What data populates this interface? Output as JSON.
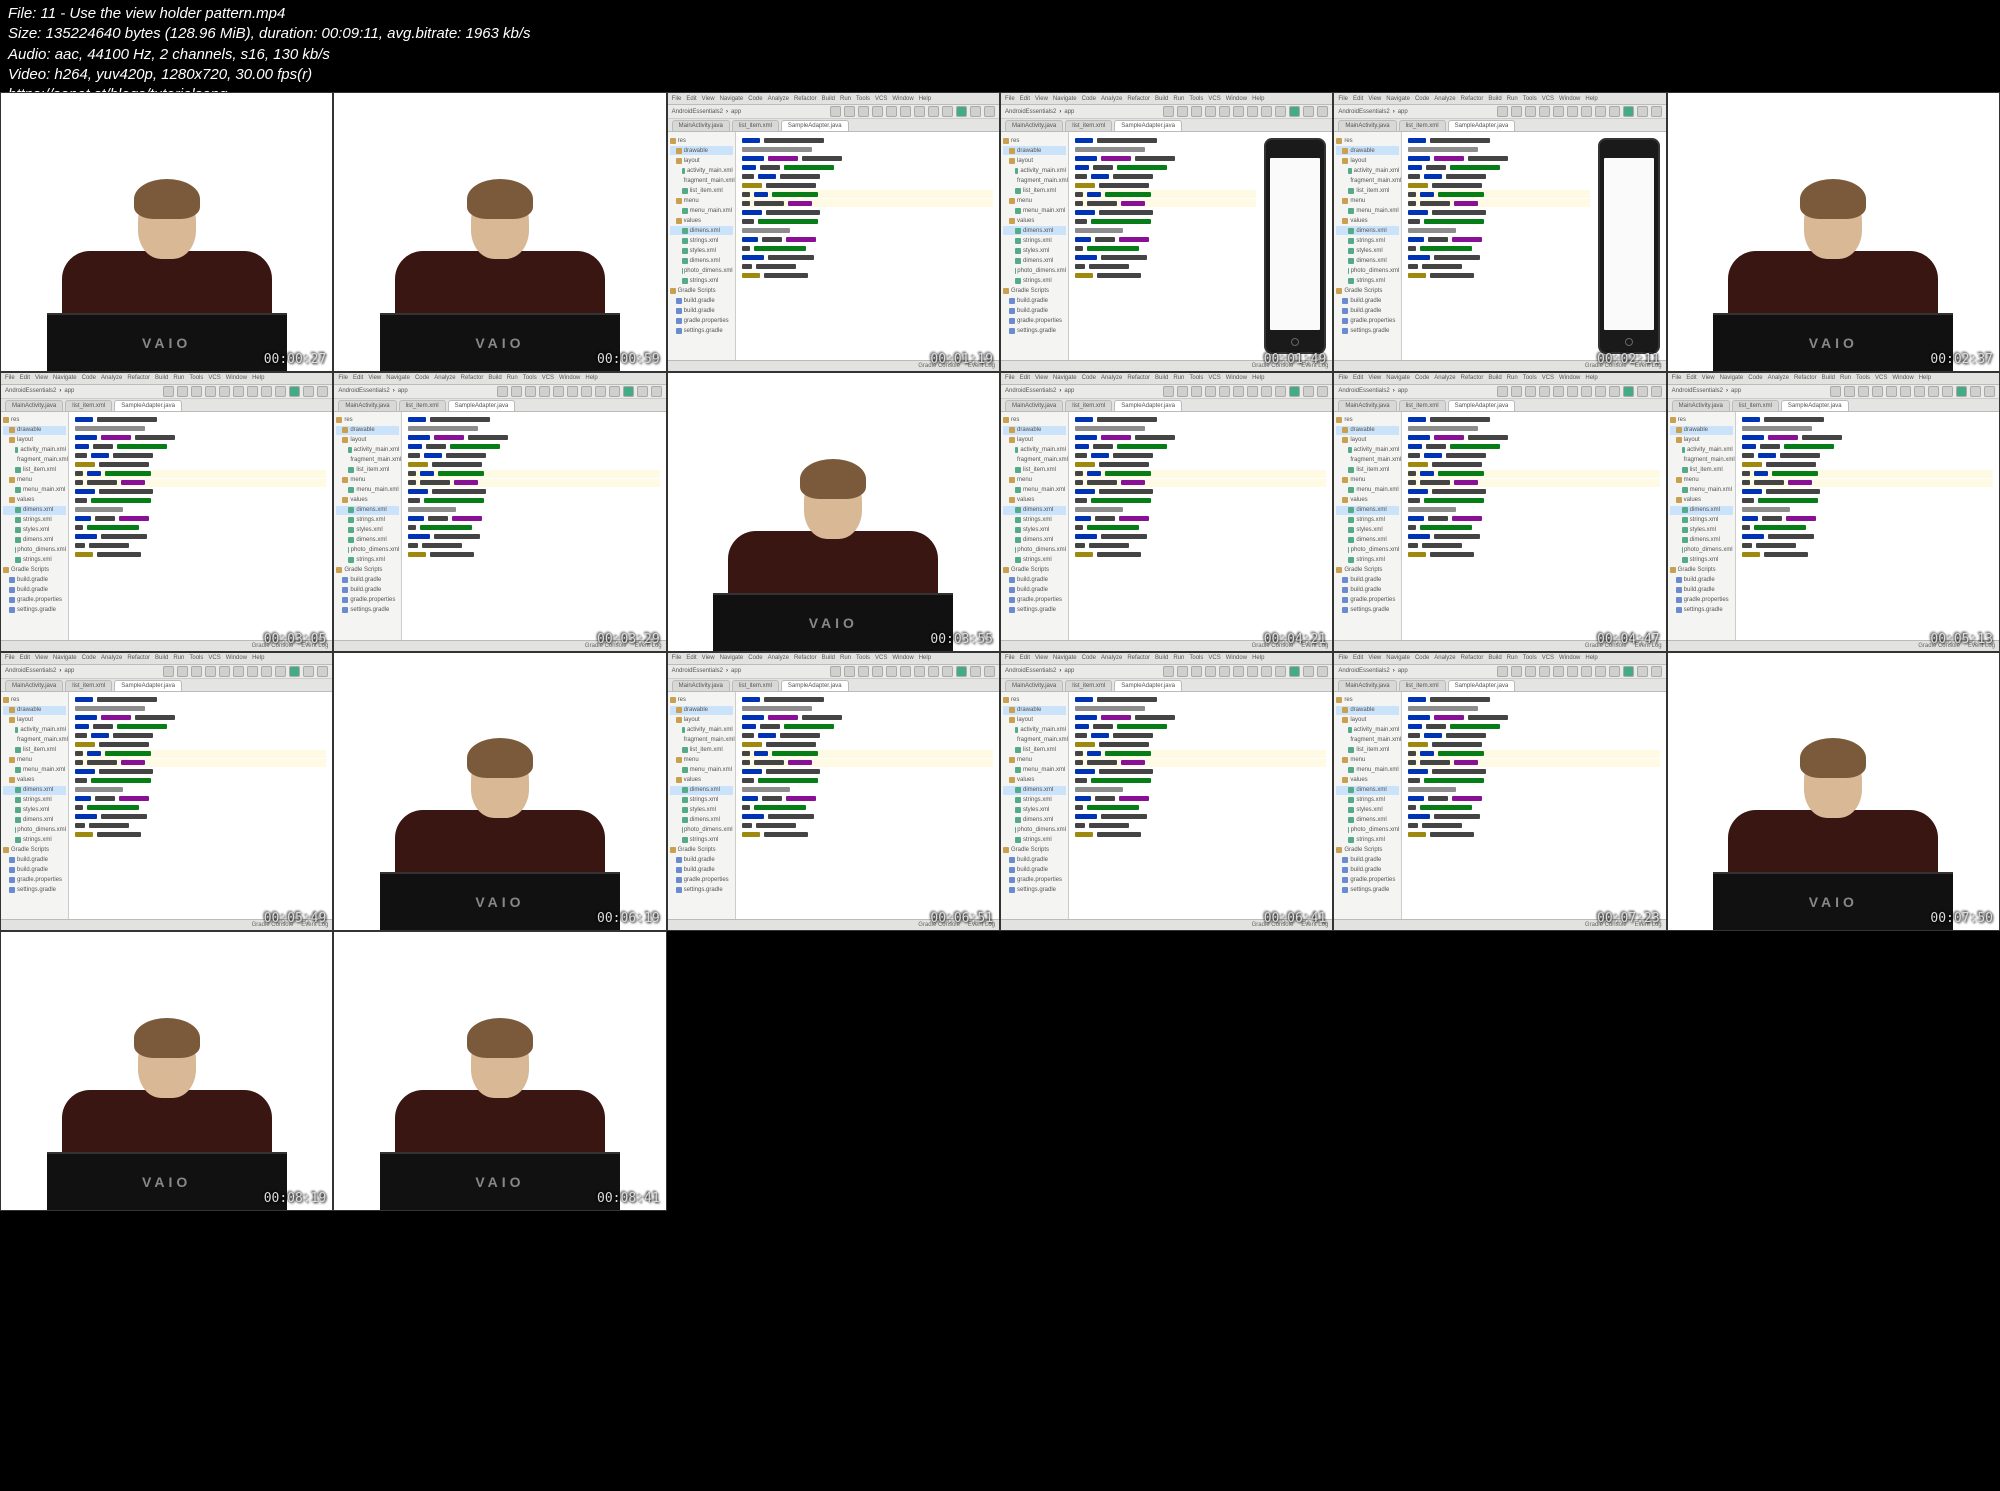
{
  "header": {
    "file": "File: 11 - Use the view holder pattern.mp4",
    "size": "Size: 135224640 bytes (128.96 MiB), duration: 00:09:11, avg.bitrate: 1963 kb/s",
    "audio": "Audio: aac, 44100 Hz, 2 channels, s16, 130 kb/s",
    "video": "Video: h264, yuv420p, 1280x720, 30.00 fps(r)",
    "url": "https://sanet.st/blogs/tutorialseng"
  },
  "ide": {
    "menu": [
      "File",
      "Edit",
      "View",
      "Navigate",
      "Code",
      "Analyze",
      "Refactor",
      "Build",
      "Run",
      "Tools",
      "VCS",
      "Window",
      "Help"
    ],
    "project_label": "AndroidEssentials2",
    "module_label": "app",
    "tabs": [
      "MainActivity.java",
      "list_item.xml",
      "SampleAdapter.java"
    ],
    "tree": [
      {
        "label": "res",
        "icon": "folder",
        "ind": 0
      },
      {
        "label": "drawable",
        "icon": "folder",
        "ind": 1,
        "hl": true
      },
      {
        "label": "layout",
        "icon": "folder",
        "ind": 1
      },
      {
        "label": "activity_main.xml",
        "icon": "xml",
        "ind": 2
      },
      {
        "label": "fragment_main.xml",
        "icon": "xml",
        "ind": 2
      },
      {
        "label": "list_item.xml",
        "icon": "xml",
        "ind": 2
      },
      {
        "label": "menu",
        "icon": "folder",
        "ind": 1
      },
      {
        "label": "menu_main.xml",
        "icon": "xml",
        "ind": 2
      },
      {
        "label": "values",
        "icon": "folder",
        "ind": 1
      },
      {
        "label": "dimens.xml",
        "icon": "xml",
        "ind": 2,
        "hl": true
      },
      {
        "label": "strings.xml",
        "icon": "xml",
        "ind": 2
      },
      {
        "label": "styles.xml",
        "icon": "xml",
        "ind": 2
      },
      {
        "label": "dimens.xml",
        "icon": "xml",
        "ind": 2
      },
      {
        "label": "photo_dimens.xml",
        "icon": "xml",
        "ind": 2
      },
      {
        "label": "strings.xml",
        "icon": "xml",
        "ind": 2
      },
      {
        "label": "Gradle Scripts",
        "icon": "folder",
        "ind": 0
      },
      {
        "label": "build.gradle",
        "icon": "java",
        "ind": 1
      },
      {
        "label": "build.gradle",
        "icon": "java",
        "ind": 1
      },
      {
        "label": "gradle.properties",
        "icon": "java",
        "ind": 1
      },
      {
        "label": "settings.gradle",
        "icon": "java",
        "ind": 1
      }
    ],
    "status_right": "Gradle Console",
    "status_event": "Event Log"
  },
  "laptop_brand": "VAIO",
  "thumbs": [
    {
      "type": "talk",
      "ts": "00:00:27"
    },
    {
      "type": "talk",
      "ts": "00:00:59"
    },
    {
      "type": "ide",
      "ts": "00:01:19",
      "device": false
    },
    {
      "type": "ide",
      "ts": "00:01:49",
      "device": true
    },
    {
      "type": "ide",
      "ts": "00:02:11",
      "device": true
    },
    {
      "type": "talk",
      "ts": "00:02:37"
    },
    {
      "type": "ide",
      "ts": "00:03:05",
      "device": false
    },
    {
      "type": "ide",
      "ts": "00:03:29",
      "device": false
    },
    {
      "type": "talk",
      "ts": "00:03:55"
    },
    {
      "type": "ide",
      "ts": "00:04:21",
      "device": false
    },
    {
      "type": "ide",
      "ts": "00:04:47",
      "device": false
    },
    {
      "type": "ide",
      "ts": "00:05:13",
      "device": false
    },
    {
      "type": "ide",
      "ts": "00:05:49",
      "device": false
    },
    {
      "type": "talk",
      "ts": "00:06:19"
    },
    {
      "type": "ide",
      "ts": "00:06:51",
      "device": false
    },
    {
      "type": "ide",
      "ts": "00:06:41",
      "device": false
    },
    {
      "type": "ide",
      "ts": "00:07:23",
      "device": false
    },
    {
      "type": "talk",
      "ts": "00:07:50"
    },
    {
      "type": "talk",
      "ts": "00:08:19"
    },
    {
      "type": "talk",
      "ts": "00:08:41"
    }
  ]
}
